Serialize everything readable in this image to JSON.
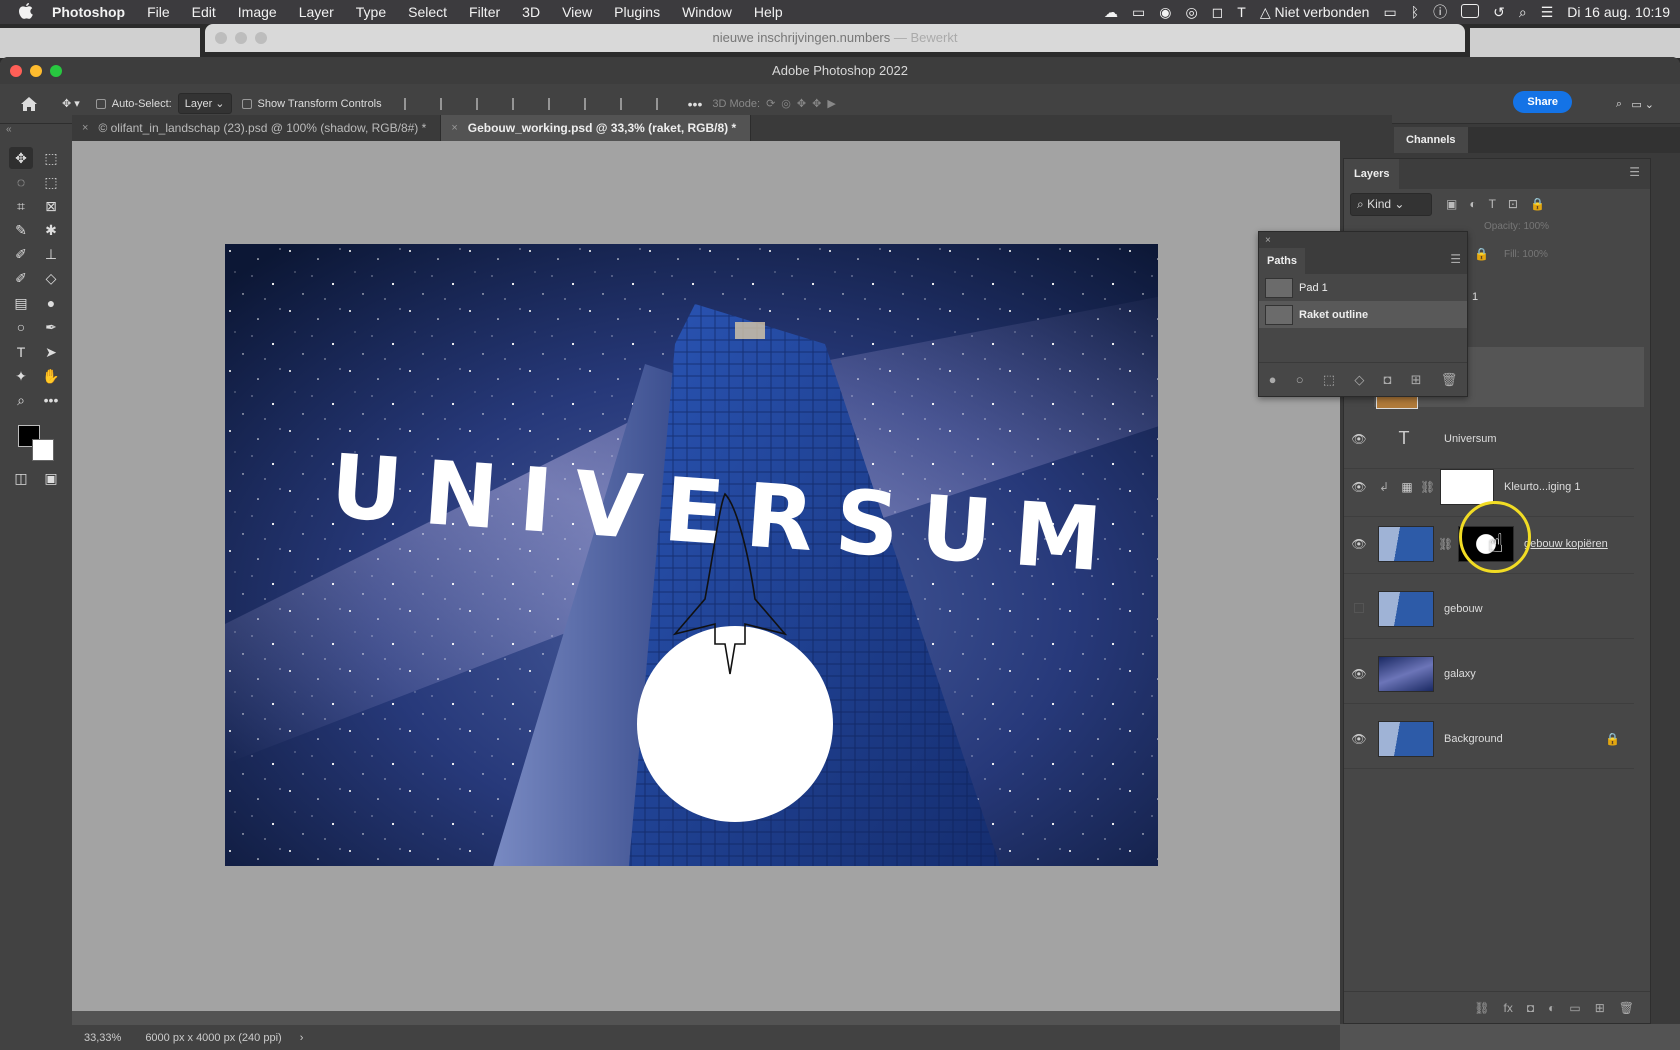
{
  "menubar": {
    "app": "Photoshop",
    "items": [
      "File",
      "Edit",
      "Image",
      "Layer",
      "Type",
      "Select",
      "Filter",
      "3D",
      "View",
      "Plugins",
      "Window",
      "Help"
    ],
    "network": "Niet verbonden",
    "datetime": "Di 16 aug.  10:19"
  },
  "background_window": {
    "title": "nieuwe inschrijvingen.numbers",
    "state": "Bewerkt"
  },
  "window": {
    "title": "Adobe Photoshop 2022"
  },
  "options": {
    "auto_select_label": "Auto-Select:",
    "auto_select_value": "Layer",
    "transform_label": "Show Transform Controls",
    "mode_3d_label": "3D Mode:",
    "share_label": "Share"
  },
  "tabs": [
    {
      "label": "© olifant_in_landschap (23).psd @ 100% (shadow, RGB/8#) *",
      "active": false
    },
    {
      "label": "Gebouw_working.psd @ 33,3% (raket, RGB/8) *",
      "active": true
    }
  ],
  "canvas": {
    "headline": "UNIVERSUM"
  },
  "status": {
    "zoom": "33,33%",
    "doc_info": "6000 px x 4000 px (240 ppi)"
  },
  "channels_tab": "Channels",
  "layers": {
    "title": "Layers",
    "filter": "Kind",
    "opacity_label": "Opacity:",
    "opacity_value": "100%",
    "fill_label": "Fill:",
    "fill_value": "100%",
    "partial_label": "1",
    "rows": [
      {
        "name": "Universum",
        "kind": "text",
        "visible": true
      },
      {
        "name": "Kleurto...iging 1",
        "kind": "adjustment",
        "visible": true
      },
      {
        "name": "gebouw kopiëren",
        "kind": "masked",
        "visible": true
      },
      {
        "name": "gebouw",
        "kind": "image",
        "visible": false
      },
      {
        "name": "galaxy",
        "kind": "image",
        "visible": true
      },
      {
        "name": "Background",
        "kind": "image",
        "visible": true,
        "locked": true
      }
    ]
  },
  "paths": {
    "title": "Paths",
    "rows": [
      {
        "name": "Pad 1",
        "selected": false
      },
      {
        "name": "Raket outline",
        "selected": true
      }
    ]
  }
}
